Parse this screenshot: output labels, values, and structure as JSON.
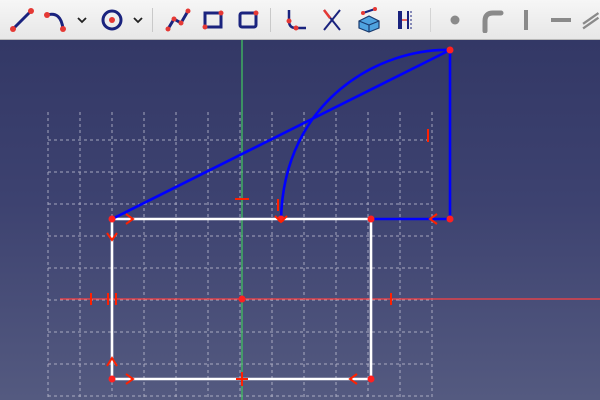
{
  "app": "Sketcher",
  "toolbar": {
    "items": [
      {
        "id": "polyline",
        "icon": "polyline-icon"
      },
      {
        "id": "arc",
        "icon": "arc-icon",
        "dropdown": true
      },
      {
        "id": "circle",
        "icon": "circle-icon",
        "dropdown": true
      },
      {
        "id": "bspline",
        "icon": "bspline-icon"
      },
      {
        "id": "rectangle",
        "icon": "rectangle-icon"
      },
      {
        "id": "rounded-rectangle",
        "icon": "rounded-rectangle-icon"
      },
      {
        "id": "fillet",
        "icon": "fillet-icon"
      },
      {
        "id": "trim",
        "icon": "trim-icon"
      },
      {
        "id": "external-geometry",
        "icon": "external-geometry-icon"
      },
      {
        "id": "carbon-copy",
        "icon": "carbon-copy-icon"
      },
      {
        "id": "point",
        "icon": "point-icon"
      },
      {
        "id": "slot",
        "icon": "slot-icon"
      },
      {
        "id": "vertical-constraint",
        "icon": "vertical-constraint-icon"
      },
      {
        "id": "horizontal-constraint",
        "icon": "horizontal-constraint-icon"
      },
      {
        "id": "parallel-constraint",
        "icon": "parallel-constraint-icon"
      }
    ]
  },
  "colors": {
    "geometry_selected": "#0000ff",
    "geometry": "#ffffff",
    "points": "#ff2020",
    "constraints": "#ff2000",
    "x_axis": "#ff4040",
    "y_axis": "#40c060",
    "grid": "#c8c8d8",
    "toolbar_icon_primary": "#1a237e",
    "toolbar_icon_accent": "#e53935"
  }
}
